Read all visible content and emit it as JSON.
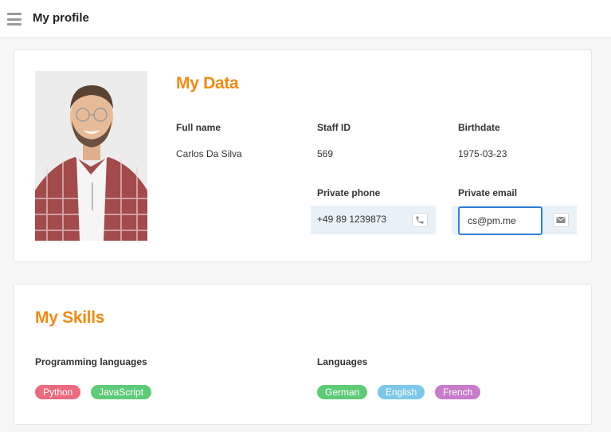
{
  "header": {
    "title": "My profile"
  },
  "my_data": {
    "title": "My Data",
    "full_name": {
      "label": "Full name",
      "value": "Carlos Da Silva"
    },
    "staff_id": {
      "label": "Staff ID",
      "value": "569"
    },
    "birthdate": {
      "label": "Birthdate",
      "value": "1975-03-23"
    },
    "private_phone": {
      "label": "Private phone",
      "value": "+49 89 1239873",
      "icon": "phone-icon"
    },
    "private_email": {
      "label": "Private email",
      "value": "cs@pm.me",
      "icon": "mail-icon"
    }
  },
  "my_skills": {
    "title": "My Skills",
    "programming": {
      "label": "Programming languages",
      "tags": [
        {
          "name": "Python",
          "color": "#ec6a7d"
        },
        {
          "name": "JavaScript",
          "color": "#5ecb77"
        }
      ]
    },
    "languages": {
      "label": "Languages",
      "tags": [
        {
          "name": "German",
          "color": "#5ecb77"
        },
        {
          "name": "English",
          "color": "#7dc7e8"
        },
        {
          "name": "French",
          "color": "#c77bc9"
        }
      ]
    }
  },
  "colors": {
    "accent": "#f18a12",
    "focus": "#2f7fd8",
    "field_bg": "#e8f0f8"
  }
}
